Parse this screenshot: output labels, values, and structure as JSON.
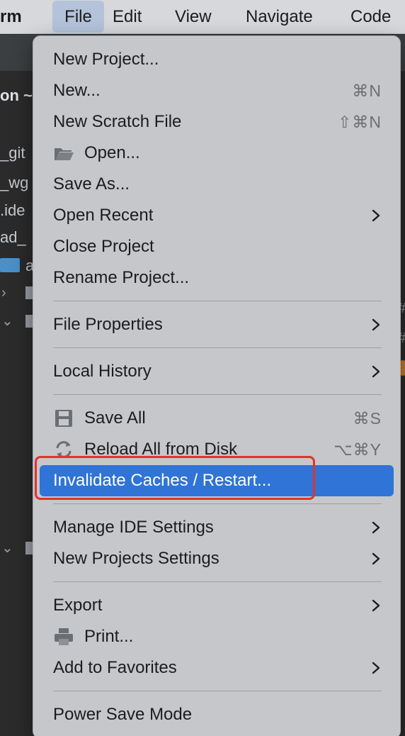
{
  "menubar": {
    "app_name": "rm",
    "items": [
      "File",
      "Edit",
      "View",
      "Navigate",
      "Code"
    ]
  },
  "background": {
    "project_label": "on ~",
    "tree_fragments": [
      "_git",
      "_wg",
      ".ide",
      "ad_",
      "a"
    ],
    "gutter_marks": [
      "#",
      "#"
    ]
  },
  "file_menu": {
    "items": {
      "new_project": {
        "label": "New Project..."
      },
      "new": {
        "label": "New...",
        "shortcut": "⌘N"
      },
      "new_scratch": {
        "label": "New Scratch File",
        "shortcut": "⇧⌘N"
      },
      "open": {
        "label": "Open...",
        "icon": "folder-icon"
      },
      "save_as": {
        "label": "Save As..."
      },
      "open_recent": {
        "label": "Open Recent"
      },
      "close_project": {
        "label": "Close Project"
      },
      "rename_project": {
        "label": "Rename Project..."
      },
      "file_properties": {
        "label": "File Properties"
      },
      "local_history": {
        "label": "Local History"
      },
      "save_all": {
        "label": "Save All",
        "shortcut": "⌘S",
        "icon": "floppy-disk-icon"
      },
      "reload_all": {
        "label": "Reload All from Disk",
        "shortcut": "⌥⌘Y",
        "icon": "reload-icon"
      },
      "invalidate_caches": {
        "label": "Invalidate Caches / Restart..."
      },
      "manage_ide_settings": {
        "label": "Manage IDE Settings"
      },
      "new_projects_settings": {
        "label": "New Projects Settings"
      },
      "export": {
        "label": "Export"
      },
      "print": {
        "label": "Print...",
        "icon": "printer-icon"
      },
      "add_to_favorites": {
        "label": "Add to Favorites"
      },
      "power_save_mode": {
        "label": "Power Save Mode"
      }
    },
    "highlight_color": "#2f74d6",
    "annotation_color": "#e2332b"
  }
}
